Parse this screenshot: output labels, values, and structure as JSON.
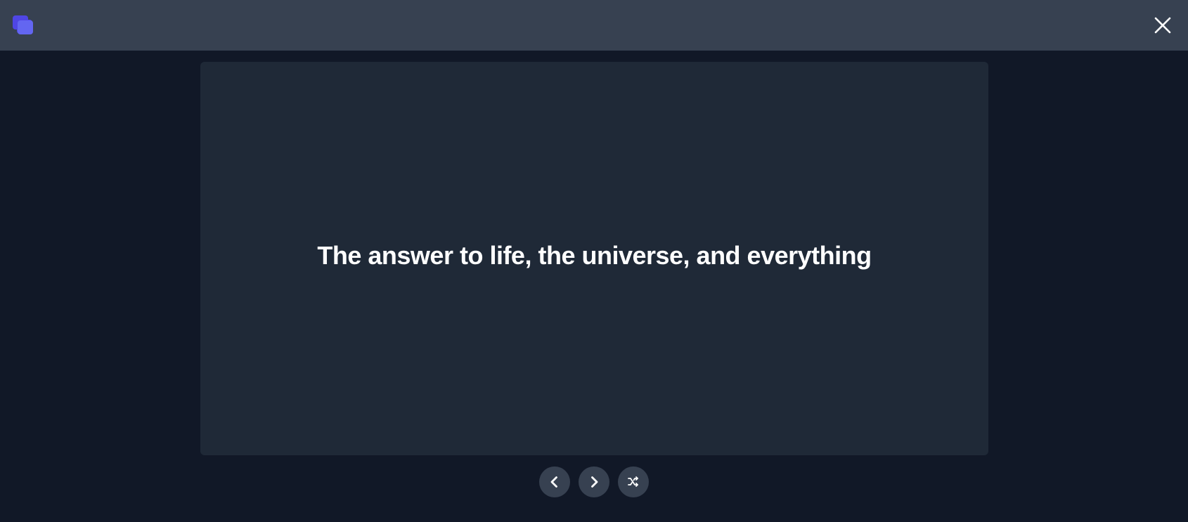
{
  "app": {
    "logo_icon": "stacked-cards-icon",
    "close_icon": "close-icon"
  },
  "card": {
    "text": "The answer to life, the universe, and everything"
  },
  "controls": {
    "previous_icon": "chevron-left-icon",
    "next_icon": "chevron-right-icon",
    "shuffle_icon": "shuffle-icon"
  },
  "colors": {
    "page_background": "#111827",
    "topbar_background": "#374151",
    "card_background": "#1f2937",
    "button_background": "#374151",
    "accent": "#6366f1",
    "text": "#ffffff"
  }
}
